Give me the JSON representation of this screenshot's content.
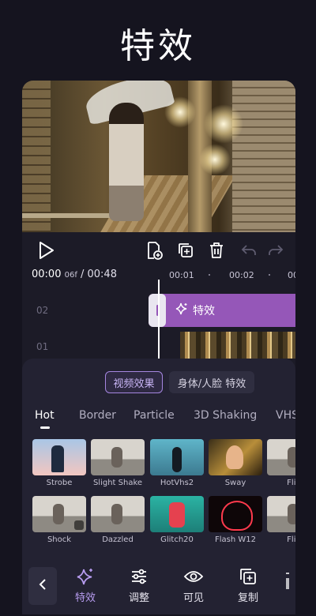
{
  "page_title": "特效",
  "editor": {
    "timecode": {
      "current": "00:00",
      "frame": "06f",
      "total": "/ 00:48"
    },
    "ruler": [
      "00:01",
      "00:02",
      "00"
    ],
    "tracks": {
      "fx_track": "02",
      "video_track": "01"
    },
    "fx_clip_label": "特效"
  },
  "panel": {
    "tabs": [
      "视频效果",
      "身体/人脸 特效"
    ],
    "categories": [
      "Hot",
      "Border",
      "Particle",
      "3D Shaking",
      "VHS"
    ],
    "effects": [
      {
        "name": "Strobe"
      },
      {
        "name": "Slight Shake"
      },
      {
        "name": "HotVhs2"
      },
      {
        "name": "Sway"
      },
      {
        "name": "Flip"
      },
      {
        "name": "Shock"
      },
      {
        "name": "Dazzled"
      },
      {
        "name": "Glitch20"
      },
      {
        "name": "Flash W12"
      },
      {
        "name": "Flip"
      }
    ]
  },
  "bottom_nav": {
    "items": [
      "特效",
      "调整",
      "可见",
      "复制"
    ]
  },
  "colors": {
    "accent": "#9557b8",
    "selected_text": "#b79cf0"
  }
}
